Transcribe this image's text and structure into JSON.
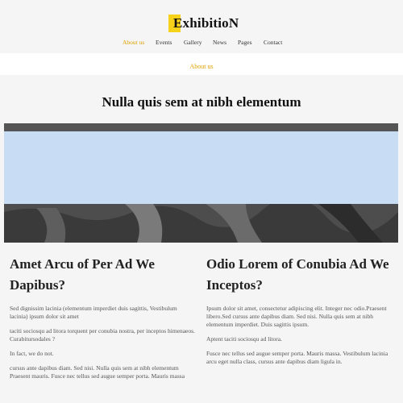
{
  "header": {
    "logo_text": "ExhibitioN",
    "accent_color": "#f7d21a",
    "nav": [
      {
        "label": "About us",
        "active": true
      },
      {
        "label": "Events"
      },
      {
        "label": "Gallery"
      },
      {
        "label": "News"
      },
      {
        "label": "Pages"
      },
      {
        "label": "Contact"
      }
    ]
  },
  "strip": {
    "label": "About us"
  },
  "hero": {
    "title": "Nulla quis sem at nibh elementum"
  },
  "left": {
    "title": "Amet Arcu of Per Ad We Dapibus?",
    "paragraphs": [
      "Sed dignissim lacinia (elementum imperdiet duis sagittis, Vestibulum lacinia) ipsum dolor sit amet",
      "taciti sociosqu ad litora torquent per conubia nostra, per inceptos himenaeos. Curabitursodales ?",
      "In fact, we do not.",
      "cursus ante dapibus diam. Sed nisi. Nulla quis sem at nibh elementum Praesent mauris. Fusce nec tellus sed augue semper porta. Mauris massa"
    ]
  },
  "right": {
    "title": "Odio Lorem of Conubia Ad We Inceptos?",
    "paragraphs": [
      "Ipsum dolor sit amet, consectetur adipiscing elit. Integer nec odio.Praesent libero.Sed cursus ante dapibus diam. Sed nisi. Nulla quis sem at nibh elementum imperdiet. Duis sagittis ipsum.",
      "Aptent taciti sociosqu ad litora.",
      "Fusce nec tellus sed augue semper porta. Mauris massa. Vestibulum lacinia arcu eget nulla class, cursus ante dapibus diam ligula in."
    ]
  }
}
